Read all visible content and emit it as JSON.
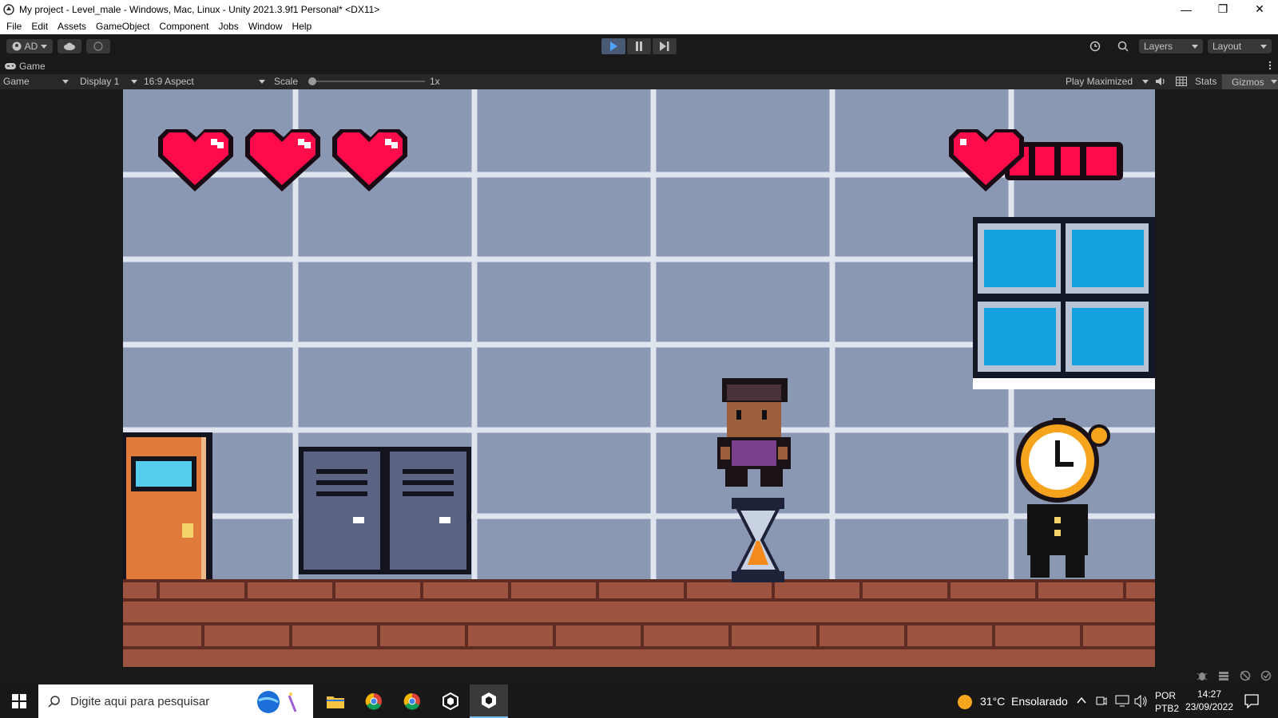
{
  "window": {
    "title": "My project - Level_male - Windows, Mac, Linux - Unity 2021.3.9f1 Personal* <DX11>",
    "minimize": "—",
    "restore": "❐",
    "close": "✕"
  },
  "menu": [
    "File",
    "Edit",
    "Assets",
    "GameObject",
    "Component",
    "Jobs",
    "Window",
    "Help"
  ],
  "toolbar": {
    "account": "AD",
    "layers": "Layers",
    "layout": "Layout"
  },
  "tab": {
    "label": "Game",
    "icon": "gamepad-icon"
  },
  "gamebar": {
    "view_select": "Game",
    "display": "Display 1",
    "aspect": "16:9 Aspect",
    "scale_label": "Scale",
    "scale_value": "1x",
    "scale_level": 0,
    "play_mode": "Play Maximized",
    "stats": "Stats",
    "gizmos": "Gizmos"
  },
  "game": {
    "lives": 3,
    "health_segments": 4,
    "colors": {
      "wall": "#8b98b4",
      "grid": "#dfe5ef",
      "heart": "#ff0a4a",
      "floor": "#9c5340",
      "door": "#e07b3b",
      "locker": "#5b6583",
      "window": "#14a1df"
    }
  },
  "taskbar": {
    "search_placeholder": "Digite aqui para pesquisar",
    "weather_temp": "31°C",
    "weather_desc": "Ensolarado",
    "lang": "POR",
    "lang_sub": "PTB2",
    "time": "14:27",
    "date": "23/09/2022"
  }
}
